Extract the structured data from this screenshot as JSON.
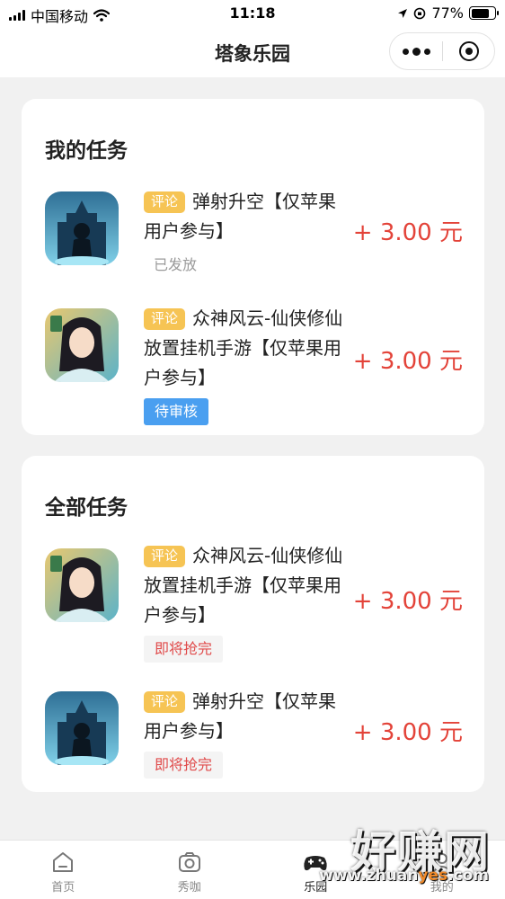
{
  "status_bar": {
    "carrier": "中国移动",
    "time": "11:18",
    "battery_text": "77%",
    "battery_level": 0.77
  },
  "nav": {
    "title": "塔象乐园"
  },
  "my_tasks": {
    "title": "我的任务",
    "items": [
      {
        "tag": "评论",
        "name": "弹射升空【仅苹果用户参与】",
        "status": "已发放",
        "status_type": "grey",
        "reward": "+ 3.00 元",
        "icon": "dark-castle-silhouette-icon"
      },
      {
        "tag": "评论",
        "name": "众神风云-仙侠修仙放置挂机手游【仅苹果用户参与】",
        "status": "待审核",
        "status_type": "blue",
        "reward": "+ 3.00 元",
        "icon": "xianxia-heroine-icon"
      }
    ]
  },
  "all_tasks": {
    "title": "全部任务",
    "items": [
      {
        "tag": "评论",
        "name": "众神风云-仙侠修仙放置挂机手游【仅苹果用户参与】",
        "status": "即将抢完",
        "status_type": "red",
        "reward": "+ 3.00 元",
        "icon": "xianxia-heroine-icon"
      },
      {
        "tag": "评论",
        "name": "弹射升空【仅苹果用户参与】",
        "status": "即将抢完",
        "status_type": "red",
        "reward": "+ 3.00 元",
        "icon": "dark-castle-silhouette-icon"
      }
    ]
  },
  "tab_bar": {
    "items": [
      {
        "label": "首页",
        "icon": "home-icon"
      },
      {
        "label": "秀咖",
        "icon": "camera-icon"
      },
      {
        "label": "乐园",
        "icon": "gamepad-icon",
        "active": true
      },
      {
        "label": "我的",
        "icon": "profile-icon"
      }
    ]
  },
  "watermark": {
    "main": "好赚网",
    "url_prefix": "www.zhuan",
    "url_highlight": "yes",
    "url_suffix": ".com"
  },
  "colors": {
    "accent_red": "#e34339",
    "tag_yellow": "#f6c454",
    "status_blue": "#4a9ff0",
    "page_bg": "#f1f1f1"
  }
}
